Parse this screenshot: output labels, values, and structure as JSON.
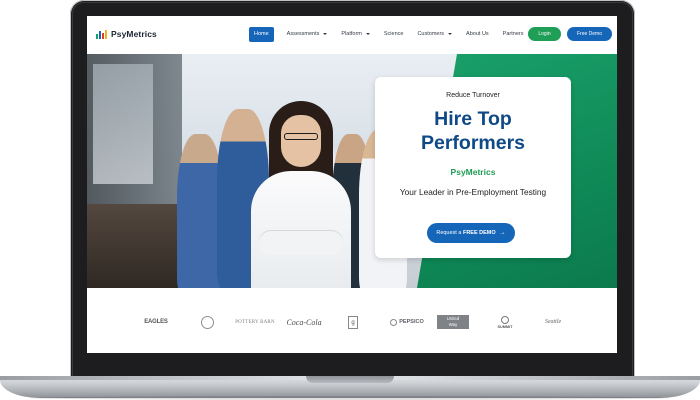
{
  "site": {
    "logo_text": "PsyMetrics",
    "logo_bar_colors": [
      "#1aa06a",
      "#1565b8",
      "#e53935",
      "#f2b21a"
    ]
  },
  "nav": {
    "items": [
      {
        "label": "Home",
        "active": true,
        "dropdown": false
      },
      {
        "label": "Assessments",
        "active": false,
        "dropdown": true
      },
      {
        "label": "Platform",
        "active": false,
        "dropdown": true
      },
      {
        "label": "Science",
        "active": false,
        "dropdown": false
      },
      {
        "label": "Customers",
        "active": false,
        "dropdown": true
      },
      {
        "label": "About Us",
        "active": false,
        "dropdown": false
      },
      {
        "label": "Partners",
        "active": false,
        "dropdown": false
      }
    ],
    "login_label": "Login",
    "demo_label": "Free Demo"
  },
  "hero": {
    "eyebrow": "Reduce Turnover",
    "headline_line1": "Hire Top",
    "headline_line2": "Performers",
    "brand": "PsyMetrics",
    "tagline": "Your Leader in Pre-Employment Testing",
    "cta_prefix": "Request a ",
    "cta_bold": "FREE DEMO",
    "cta_arrow": "→"
  },
  "clients": [
    {
      "name": "Eagles",
      "text": "EAGLES"
    },
    {
      "name": "seal",
      "text": ""
    },
    {
      "name": "Pottery Barn",
      "text": "POTTERY BARN"
    },
    {
      "name": "Coca-Cola",
      "text": "Coca-Cola"
    },
    {
      "name": "Goodwill",
      "text": "g"
    },
    {
      "name": "PepsiCo",
      "text": "PEPSICO"
    },
    {
      "name": "United Way",
      "text_1": "United",
      "text_2": "Way"
    },
    {
      "name": "Summit",
      "text": "SUMMIT"
    },
    {
      "name": "script logo",
      "text": "Seattle"
    }
  ],
  "colors": {
    "primary_blue": "#1565b8",
    "green": "#1e9e57",
    "headline_blue": "#0f4a87"
  }
}
